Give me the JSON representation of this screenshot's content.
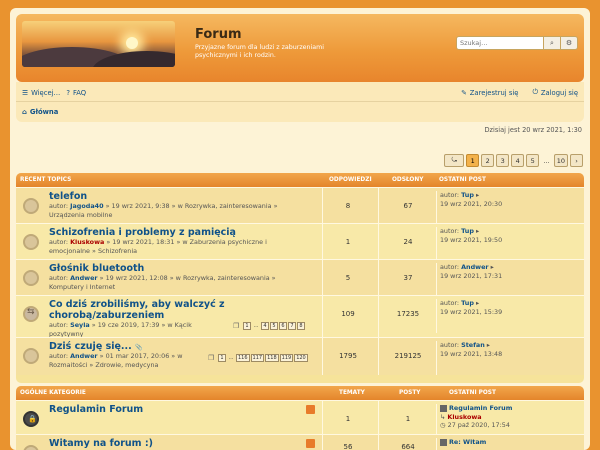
{
  "header": {
    "title": "Forum",
    "description": "Przyjazne forum dla ludzi z zaburzeniami psychicznymi i ich rodzin.",
    "search_placeholder": "Szukaj…",
    "search_icon": "search-icon",
    "advanced_icon": "gear-icon"
  },
  "nav": {
    "more": "Więcej…",
    "faq": "FAQ",
    "register": "Zarejestruj się",
    "login": "Zaloguj się",
    "breadcrumb": "Główna"
  },
  "date_line": "Dzisiaj jest 20 wrz 2021, 1:30",
  "pagination": {
    "pages": [
      "1",
      "2",
      "3",
      "4",
      "5",
      "…",
      "10"
    ],
    "active": "1"
  },
  "topics_block": {
    "head_title": "RECENT TOPICS",
    "head_answers": "ODPOWIEDZI",
    "head_views": "ODSŁONY",
    "head_last": "OSTATNI POST",
    "rows": [
      {
        "title": "telefon",
        "meta_prefix": "autor:",
        "author": "Jagoda40",
        "meta_mid": "» 19 wrz 2021, 9:38 » w Rozrywka, zainteresowania »",
        "meta_line2": "Urządzenia mobilne",
        "answers": "8",
        "views": "67",
        "last_prefix": "autor:",
        "last_author": "Tup",
        "last_date": "19 wrz 2021, 20:30"
      },
      {
        "title": "Schizofrenia i problemy z pamięcią",
        "meta_prefix": "autor:",
        "author": "Kluskowa",
        "meta_mid": "» 19 wrz 2021, 18:31 » w Zaburzenia psychiczne i",
        "meta_line2": "emocjonalne » Schizofrenia",
        "answers": "1",
        "views": "24",
        "last_prefix": "autor:",
        "last_author": "Tup",
        "last_date": "19 wrz 2021, 19:50"
      },
      {
        "title": "Głośnik bluetooth",
        "meta_prefix": "autor:",
        "author": "Andwer",
        "meta_mid": "» 19 wrz 2021, 12:08 » w Rozrywka, zainteresowania »",
        "meta_line2": "Komputery i Internet",
        "answers": "5",
        "views": "37",
        "last_prefix": "autor:",
        "last_author": "Andwer",
        "last_date": "19 wrz 2021, 17:31"
      },
      {
        "title": "Co dziś zrobiliśmy, aby walczyć z",
        "title_line2": "chorobą/zaburzeniem",
        "meta_prefix": "autor:",
        "author": "Seyla",
        "meta_mid": "» 19 cze 2019, 17:39 » w Kącik",
        "meta_line2": "pozytywny",
        "pages": [
          "1",
          "…",
          "4",
          "5",
          "6",
          "7",
          "8"
        ],
        "answers": "109",
        "views": "17235",
        "last_prefix": "autor:",
        "last_author": "Tup",
        "last_date": "19 wrz 2021, 15:39"
      },
      {
        "title": "Dziś czuję się...",
        "meta_prefix": "autor:",
        "author": "Andwer",
        "meta_mid": "» 01 mar 2017, 20:06 » w",
        "meta_line2": "Rozmaitości » Zdrowie, medycyna",
        "pages": [
          "1",
          "…",
          "116",
          "117",
          "118",
          "119",
          "120"
        ],
        "answers": "1795",
        "views": "219125",
        "last_prefix": "autor:",
        "last_author": "Stefan",
        "last_date": "19 wrz 2021, 13:48"
      }
    ]
  },
  "categories_block": {
    "head_title": "OGÓLNE KATEGORIE",
    "head_topics": "TEMATY",
    "head_posts": "POSTY",
    "head_last": "OSTATNI POST",
    "rows": [
      {
        "title": "Regulamin Forum",
        "topics": "1",
        "posts": "1",
        "last_title": "Regulamin Forum",
        "last_author": "Kluskowa",
        "last_date": "27 paź 2020, 17:54"
      },
      {
        "title": "Witamy na forum :)",
        "topics": "56",
        "posts": "664",
        "last_title": "Re: Witam"
      }
    ]
  },
  "colors": {
    "accent": "#e9932f",
    "link": "#105289",
    "row_bg": "#f6e39a"
  }
}
